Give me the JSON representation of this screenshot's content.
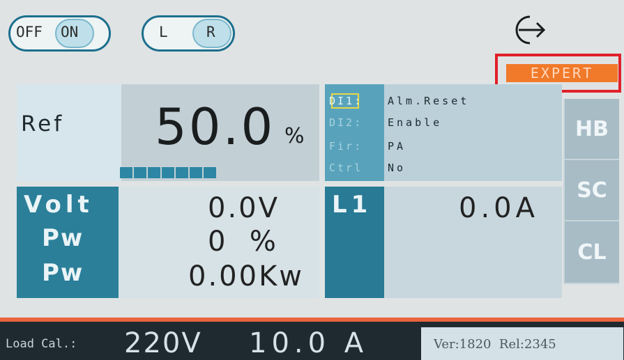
{
  "top": {
    "power_off": "OFF",
    "power_on": "ON",
    "side_left": "L",
    "side_right": "R",
    "mode_badge": "EXPERT"
  },
  "ref": {
    "label": "Ref",
    "value": "50.0",
    "unit": "%"
  },
  "di": [
    {
      "key": "DI1:",
      "value": "Alm.Reset"
    },
    {
      "key": "DI2:",
      "value": "Enable"
    },
    {
      "key": "Fir:",
      "value": "PA"
    },
    {
      "key": "Ctrl",
      "value": "No"
    }
  ],
  "readings": {
    "volt_label": "Volt",
    "volt_value": "0.0V",
    "pw1_label": "Pw",
    "pw1_value": "0  %",
    "pw2_label": "Pw",
    "pw2_value": "0.00Kw",
    "l1_label": "L1",
    "l1_value": "0.0A"
  },
  "side_buttons": [
    "HB",
    "SC",
    "CL"
  ],
  "status": {
    "load_label": "Load Cal.:",
    "load_voltage": "220V",
    "load_current": "10.0 A",
    "version": "Ver:1820  Rel:2345"
  }
}
